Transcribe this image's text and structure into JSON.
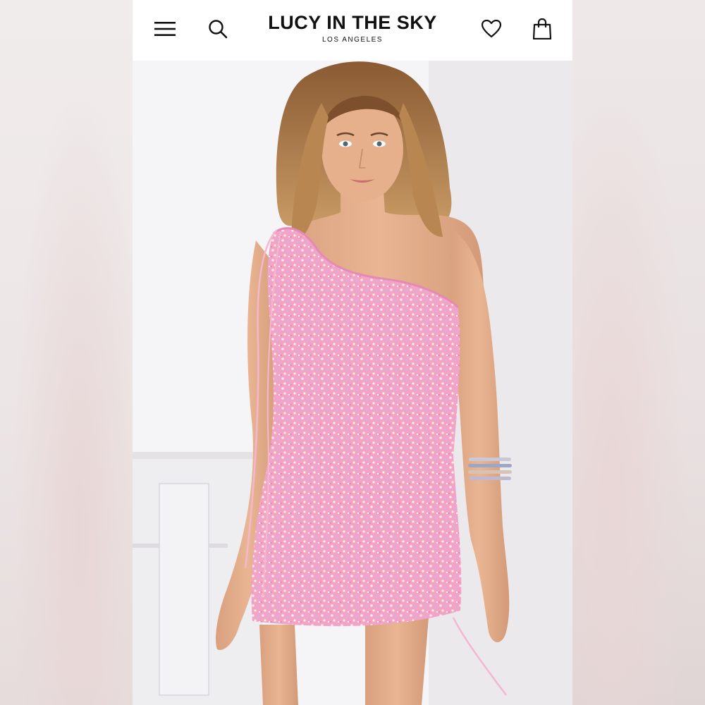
{
  "brand": {
    "title": "LUCY IN THE SKY",
    "subtitle": "LOS ANGELES"
  },
  "header": {
    "icons": [
      "menu-icon",
      "search-icon",
      "heart-icon",
      "shopping-bag-icon"
    ]
  },
  "product_image": {
    "subject": "",
    "dress_color": "#f3a3c6"
  },
  "colors": {
    "header_bg": "#ffffff",
    "brand_text": "#111111",
    "dress_pink": "#f3a3c6"
  }
}
